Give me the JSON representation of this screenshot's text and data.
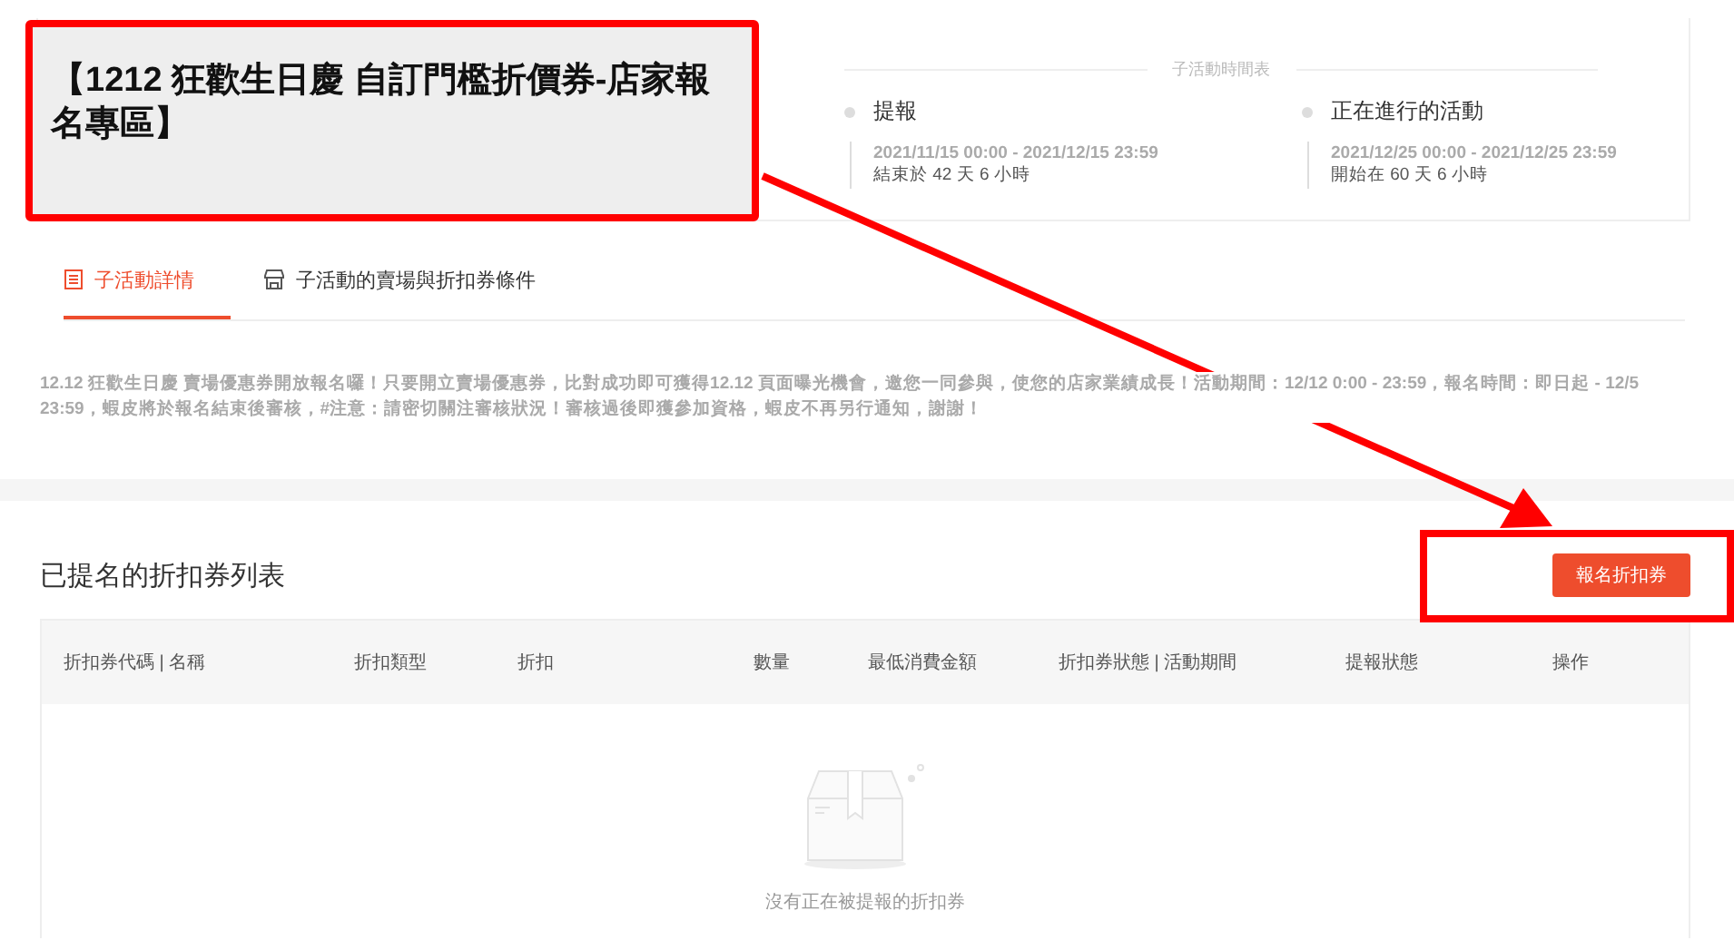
{
  "title": "【1212 狂歡生日慶 自訂門檻折價券-店家報名專區】",
  "schedule": {
    "heading": "子活動時間表",
    "phases": [
      {
        "name": "提報",
        "period": "2021/11/15 00:00 - 2021/12/15 23:59",
        "countdown": "結束於 42 天 6 小時"
      },
      {
        "name": "正在進行的活動",
        "period": "2021/12/25 00:00 - 2021/12/25 23:59",
        "countdown": "開始在 60 天 6 小時"
      }
    ]
  },
  "tabs": [
    {
      "label": "子活動詳情",
      "selected": true,
      "kind": "list"
    },
    {
      "label": "子活動的賣場與折扣券條件",
      "selected": false,
      "kind": "shop"
    }
  ],
  "description": "12.12 狂歡生日慶 賣場優惠券開放報名囉！只要開立賣場優惠券，比對成功即可獲得12.12 頁面曝光機會，邀您一同參與，使您的店家業績成長！活動期間：12/12 0:00 - 23:59，報名時間：即日起 - 12/5 23:59，蝦皮將於報名結束後審核，#注意：請密切關注審核狀況！審核過後即獲參加資格，蝦皮不再另行通知，謝謝！",
  "list": {
    "title": "已提名的折扣券列表",
    "button": "報名折扣券",
    "table": {
      "columns": [
        "折扣券代碼 | 名稱",
        "折扣類型",
        "折扣",
        "數量",
        "最低消費金額",
        "折扣券狀態 | 活動期間",
        "提報狀態",
        "操作"
      ]
    },
    "empty_text": "沒有正在被提報的折扣券"
  }
}
